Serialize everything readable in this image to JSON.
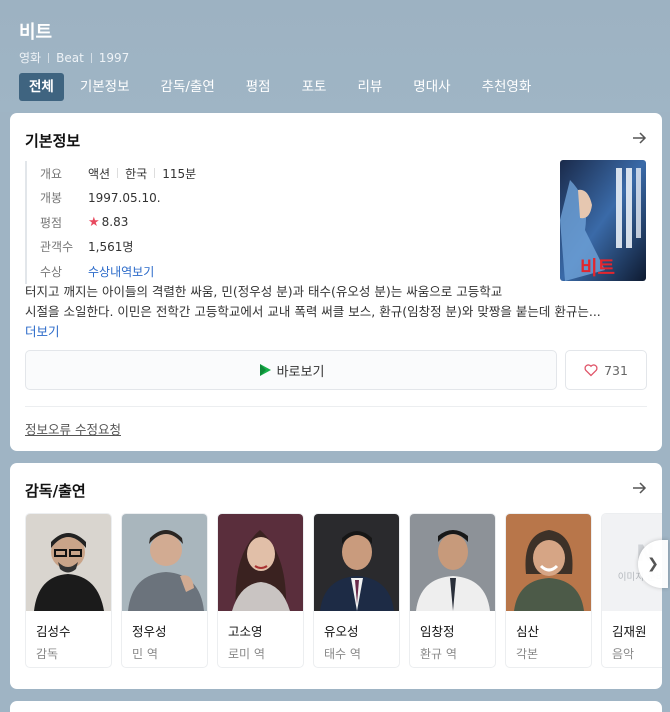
{
  "header": {
    "title": "비트",
    "category": "영화",
    "english_title": "Beat",
    "year": "1997",
    "tabs": [
      {
        "label": "전체",
        "active": true
      },
      {
        "label": "기본정보"
      },
      {
        "label": "감독/출연"
      },
      {
        "label": "평점"
      },
      {
        "label": "포토"
      },
      {
        "label": "리뷰"
      },
      {
        "label": "명대사"
      },
      {
        "label": "추천영화"
      }
    ]
  },
  "basic_info": {
    "title": "기본정보",
    "rows": {
      "genre_key": "개요",
      "genre": "액션",
      "country": "한국",
      "runtime": "115분",
      "release_key": "개봉",
      "release": "1997.05.10.",
      "rating_key": "평점",
      "rating": "8.83",
      "audience_key": "관객수",
      "audience": "1,561명",
      "awards_key": "수상",
      "awards": "수상내역보기"
    },
    "poster_text": "비트",
    "synopsis_line1": "터지고 깨지는 아이들의 격렬한 싸움, 민(정우성 분)과 태수(유오성 분)는 싸움으로 고등학교",
    "synopsis_line2": "시절을 소일한다. 이민은 전학간 고등학교에서 교내 폭력 써클 보스, 환규(임창정 분)와 맞짱을 붙는데 환규는...",
    "more": "더보기",
    "watch_label": "바로보기",
    "like_count": "731",
    "report_label": "정보오류 수정요청",
    "colors": {
      "star": "#e84a5f",
      "link": "#2b6ac9",
      "tab_active": "#3f6480"
    }
  },
  "cast": {
    "title": "감독/출연",
    "people": [
      {
        "name": "김성수",
        "role": "감독"
      },
      {
        "name": "정우성",
        "role": "민 역"
      },
      {
        "name": "고소영",
        "role": "로미 역"
      },
      {
        "name": "유오성",
        "role": "태수 역"
      },
      {
        "name": "임창정",
        "role": "환규 역"
      },
      {
        "name": "심산",
        "role": "각본"
      },
      {
        "name": "김재원",
        "role": "음악"
      }
    ],
    "no_image_mark": "N",
    "no_image_text": "이미지 준비중"
  }
}
